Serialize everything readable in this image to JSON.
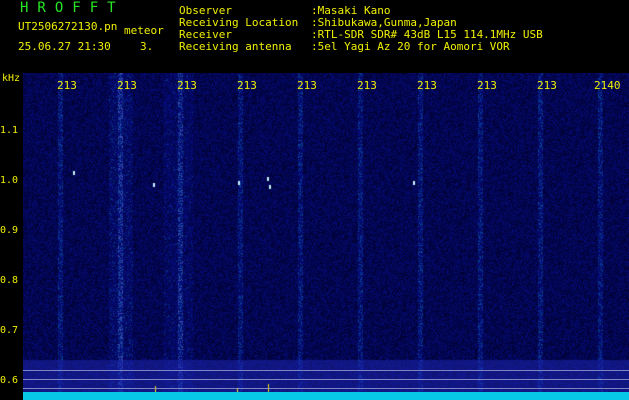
{
  "header": {
    "brand": "HROFFT",
    "filename": "UT2506272130.pn",
    "mode_label": "meteor",
    "datetime": "25.06.27 21:30",
    "count": "3.",
    "meta": [
      {
        "key": "Observer",
        "value": ":Masaki Kano"
      },
      {
        "key": "Receiving Location",
        "value": ":Shibukawa,Gunma,Japan"
      },
      {
        "key": "Receiver",
        "value": ":RTL-SDR SDR# 43dB L15 114.1MHz USB"
      },
      {
        "key": "Receiving antenna",
        "value": ":5el Yagi Az 20 for Aomori VOR"
      }
    ]
  },
  "axes": {
    "y_unit": "kHz",
    "y_ticks": [
      "1.1",
      "1.0",
      "0.9",
      "0.8",
      "0.7",
      "0.6"
    ],
    "x_ticks": [
      "213",
      "213",
      "213",
      "213",
      "213",
      "213",
      "213",
      "213",
      "213",
      "2140"
    ]
  },
  "colors": {
    "header_text": "#f0f000",
    "brand": "#26e626",
    "background": "#05062e",
    "signal": "#08c8e8"
  }
}
